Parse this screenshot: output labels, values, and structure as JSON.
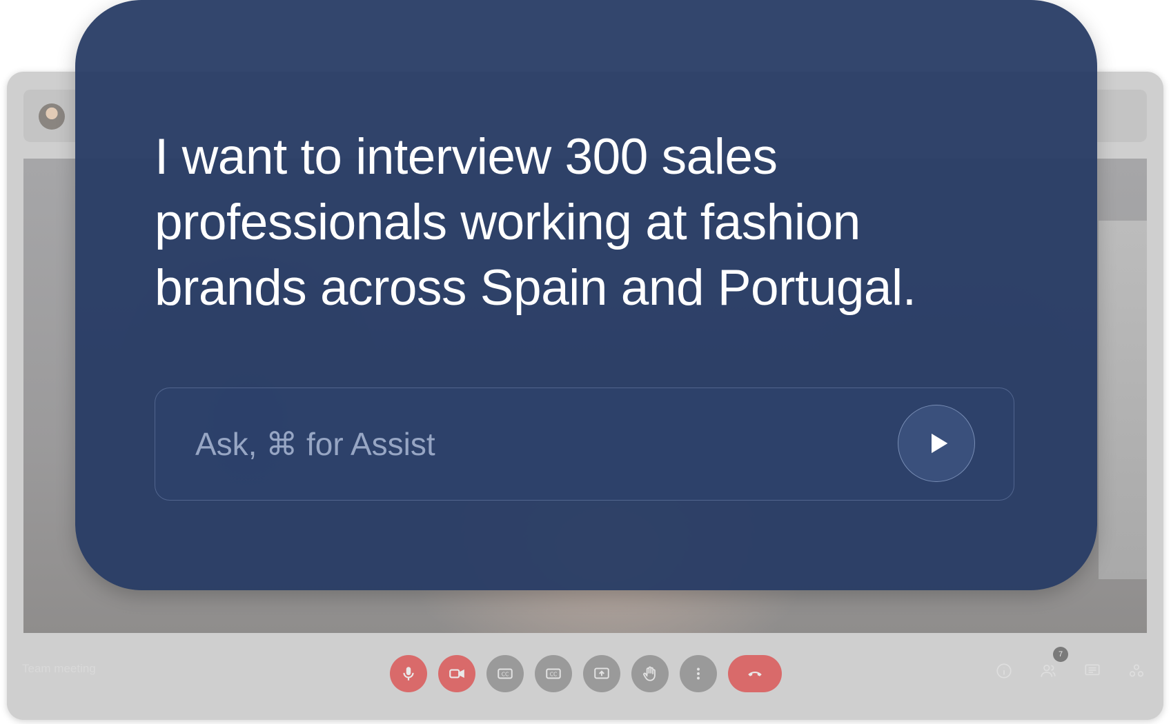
{
  "meeting": {
    "title": "Team meeting",
    "participants_count": "7"
  },
  "controls": [
    {
      "name": "microphone-button",
      "icon": "microphone-icon"
    },
    {
      "name": "camera-button",
      "icon": "video-camera-icon"
    },
    {
      "name": "captions-button",
      "icon": "closed-captions-icon"
    },
    {
      "name": "captions-language-button",
      "icon": "closed-captions-icon"
    },
    {
      "name": "present-screen-button",
      "icon": "present-screen-icon"
    },
    {
      "name": "raise-hand-button",
      "icon": "hand-icon"
    },
    {
      "name": "more-options-button",
      "icon": "more-vertical-icon"
    },
    {
      "name": "end-call-button",
      "icon": "phone-hangup-icon"
    }
  ],
  "side_icons": [
    "info-icon",
    "people-icon",
    "chat-icon",
    "activities-icon"
  ],
  "prompt": {
    "text": "I want to interview 300 sales professionals working at fashion brands across Spain and Portugal.",
    "input_placeholder": "Ask, ⌘ for Assist",
    "submit_icon": "play-icon"
  },
  "colors": {
    "card": "#263a64",
    "mute_red": "#d96a6a",
    "control_gray": "#9a9a9a",
    "placeholder": "#97a6c4"
  }
}
